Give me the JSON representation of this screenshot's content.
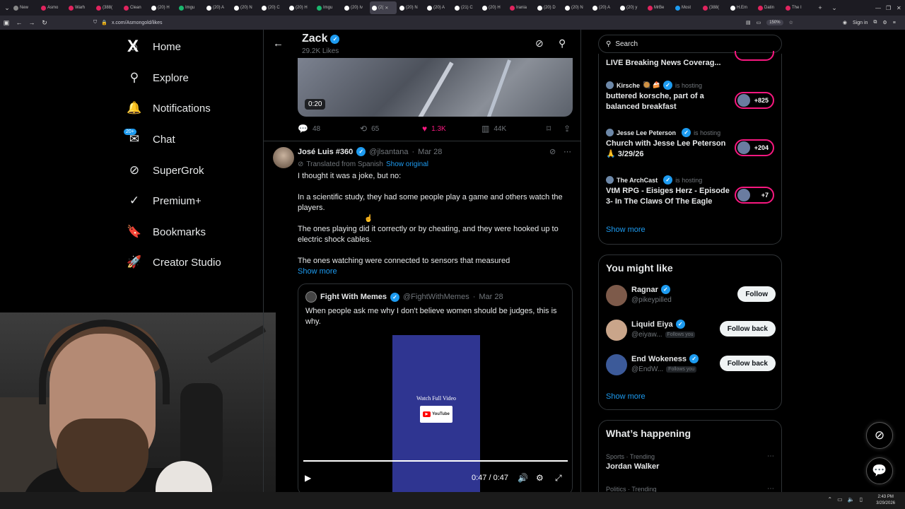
{
  "browser": {
    "tabs": [
      {
        "label": "New",
        "color": "#888888"
      },
      {
        "label": "Asmo",
        "color": "#e0245e"
      },
      {
        "label": "Warh",
        "color": "#e0245e"
      },
      {
        "label": "(388(",
        "color": "#e0245e"
      },
      {
        "label": "Clean",
        "color": "#e0245e"
      },
      {
        "label": "(20) H",
        "color": "#ffffff"
      },
      {
        "label": "Imgu",
        "color": "#1bb76e"
      },
      {
        "label": "(20) A",
        "color": "#ffffff"
      },
      {
        "label": "(20) N",
        "color": "#ffffff"
      },
      {
        "label": "(20) C",
        "color": "#ffffff"
      },
      {
        "label": "(20) H",
        "color": "#ffffff"
      },
      {
        "label": "Imgu",
        "color": "#1bb76e"
      },
      {
        "label": "(20) Iv",
        "color": "#ffffff"
      },
      {
        "label": "(2(",
        "color": "#ffffff",
        "active": true
      },
      {
        "label": "(20) N",
        "color": "#ffffff"
      },
      {
        "label": "(20) A",
        "color": "#ffffff"
      },
      {
        "label": "(21) C",
        "color": "#ffffff"
      },
      {
        "label": "(20) H",
        "color": "#ffffff"
      },
      {
        "label": "Irania",
        "color": "#e0245e"
      },
      {
        "label": "(20) D",
        "color": "#ffffff"
      },
      {
        "label": "(20) N",
        "color": "#ffffff"
      },
      {
        "label": "(20) A",
        "color": "#ffffff"
      },
      {
        "label": "(20) y",
        "color": "#ffffff"
      },
      {
        "label": "MrBe",
        "color": "#e0245e"
      },
      {
        "label": "Most",
        "color": "#1d9bf0"
      },
      {
        "label": "(388(",
        "color": "#e0245e"
      },
      {
        "label": "H.Em",
        "color": "#ffffff"
      },
      {
        "label": "Datin",
        "color": "#e0245e"
      },
      {
        "label": "The I",
        "color": "#e0245e"
      }
    ],
    "url": "x.com/Asmongold/likes",
    "zoom": "150%",
    "sign_in": "Sign in"
  },
  "sidebar": {
    "logo": "X",
    "notif_badge": "20+",
    "items": [
      {
        "label": "Home",
        "icon": "home-icon",
        "glyph": "⌂"
      },
      {
        "label": "Explore",
        "icon": "search-icon",
        "glyph": "⚲"
      },
      {
        "label": "Notifications",
        "icon": "bell-icon",
        "glyph": "🔔"
      },
      {
        "label": "Chat",
        "icon": "mail-icon",
        "glyph": "✉"
      },
      {
        "label": "SuperGrok",
        "icon": "grok-icon",
        "glyph": "⊘"
      },
      {
        "label": "Premium+",
        "icon": "premium-icon",
        "glyph": "✓"
      },
      {
        "label": "Bookmarks",
        "icon": "bookmark-icon",
        "glyph": "🔖"
      },
      {
        "label": "Creator Studio",
        "icon": "rocket-icon",
        "glyph": "🚀"
      }
    ]
  },
  "header": {
    "name": "Zack",
    "subtitle": "29.2K Likes"
  },
  "top_tweet": {
    "video_time": "0:20",
    "actions": {
      "replies": "48",
      "retweets": "65",
      "likes": "1.3K",
      "views": "44K"
    }
  },
  "tweet": {
    "name": "José Luis #360",
    "handle": "@jlsantana",
    "date": "Mar 28",
    "translated": "Translated from Spanish",
    "show_original": "Show original",
    "paragraphs": [
      "I thought it was a joke, but no:",
      "In a scientific study, they had some people play a game and others watch the players.",
      "The ones playing did it correctly or by cheating, and they were hooked up to electric shock cables.",
      "The ones watching were connected to sensors that measured"
    ],
    "show_more": "Show more",
    "quote": {
      "name": "Fight With Memes",
      "handle": "@FightWithMemes",
      "date": "Mar 28",
      "text": "When people ask me why I don't believe women should be judges, this is why.",
      "poster_text": "Watch Full Video",
      "yt_label": "YouTube",
      "time": "0:47 / 0:47",
      "progress": 1.0
    }
  },
  "right": {
    "search_placeholder": "Search",
    "live_top": "LIVE Breaking News Coverag...",
    "spaces": [
      {
        "host": "Kirsche",
        "emojis": "🥘 🍰",
        "hosting": "is hosting",
        "title": "buttered korsche, part of a balanced breakfast",
        "count": "+825"
      },
      {
        "host": "Jesse Lee Peterson",
        "emojis": "",
        "hosting": "is hosting",
        "title": "Church with Jesse Lee Peterson 🙏 3/29/26",
        "count": "+204"
      },
      {
        "host": "The ArchCast",
        "emojis": "",
        "hosting": "is hosting",
        "title": "VtM RPG - Eisiges Herz - Episode 3- In The Claws Of The Eagle",
        "count": "+7"
      }
    ],
    "spaces_show_more": "Show more",
    "wtf_title": "You might like",
    "wtf": [
      {
        "name": "Ragnar",
        "handle": "@pikeypilled",
        "follows_you": "",
        "button": "Follow",
        "color": "#7d5a4a"
      },
      {
        "name": "Liquid Eiya",
        "handle": "@eiyaw...",
        "follows_you": "Follows you",
        "button": "Follow back",
        "color": "#c9a58a"
      },
      {
        "name": "End Wokeness",
        "handle": "@EndW...",
        "follows_you": "Follows you",
        "button": "Follow back",
        "color": "#3c5a99"
      }
    ],
    "wtf_show_more": "Show more",
    "happening_title": "What’s happening",
    "trends": [
      {
        "meta": "Sports · Trending",
        "name": "Jordan Walker"
      },
      {
        "meta": "Politics · Trending",
        "name": ""
      }
    ]
  },
  "taskbar": {
    "time": "2:43 PM",
    "date": "3/29/2026"
  }
}
